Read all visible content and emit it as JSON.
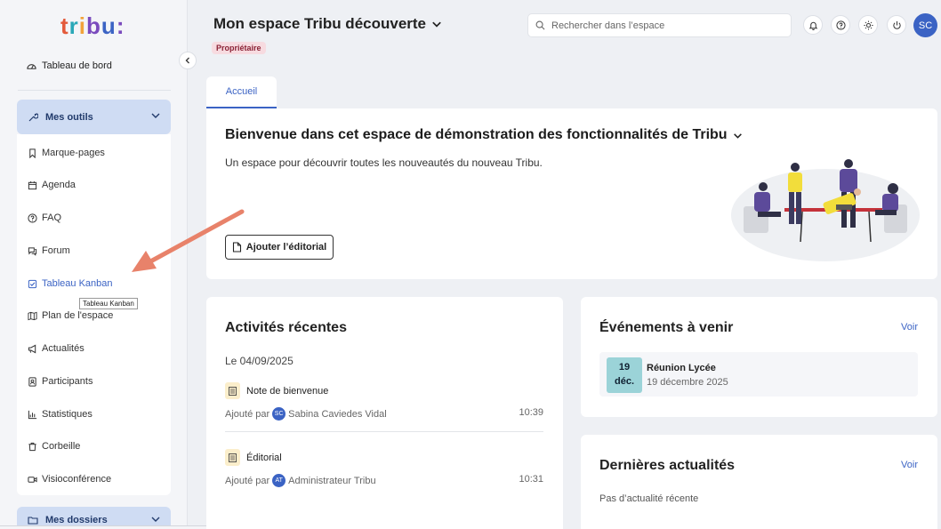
{
  "sidebar": {
    "logo": {
      "parts": [
        "t",
        "r",
        "i",
        "b",
        "u",
        ":"
      ]
    },
    "dashboard_label": "Tableau de bord",
    "tools_label": "Mes outils",
    "tools": [
      {
        "label": "Marque-pages",
        "icon": "bookmark-icon"
      },
      {
        "label": "Agenda",
        "icon": "calendar-icon"
      },
      {
        "label": "FAQ",
        "icon": "help-circle-icon"
      },
      {
        "label": "Forum",
        "icon": "forum-icon"
      },
      {
        "label": "Tableau Kanban",
        "icon": "kanban-check-icon"
      },
      {
        "label": "Plan de l'espace",
        "icon": "map-icon"
      },
      {
        "label": "Actualités",
        "icon": "megaphone-icon"
      },
      {
        "label": "Participants",
        "icon": "contacts-icon"
      },
      {
        "label": "Statistiques",
        "icon": "bar-chart-icon"
      },
      {
        "label": "Corbeille",
        "icon": "trash-icon"
      },
      {
        "label": "Visioconférence",
        "icon": "video-icon"
      }
    ],
    "tooltip": "Tableau Kanban",
    "folders_label": "Mes dossiers"
  },
  "header": {
    "space_title": "Mon espace Tribu découverte",
    "role_badge": "Propriétaire",
    "search_placeholder": "Rechercher dans l’espace",
    "avatar_initials": "SC"
  },
  "tabs": [
    {
      "label": "Accueil"
    }
  ],
  "welcome": {
    "title": "Bienvenue dans cet espace de démonstration des fonctionnalités de Tribu",
    "description": "Un espace pour découvrir toutes les nouveautés du nouveau Tribu.",
    "edit_button": "Ajouter l’éditorial"
  },
  "activities": {
    "title": "Activités récentes",
    "date": "Le 04/09/2025",
    "items": [
      {
        "title": "Note de bienvenue",
        "added_by": "Ajouté par",
        "initials": "SC",
        "author": "Sabina Caviedes Vidal",
        "time": "10:39"
      },
      {
        "title": "Éditorial",
        "added_by": "Ajouté par",
        "initials": "AT",
        "author": "Administrateur Tribu",
        "time": "10:31"
      }
    ]
  },
  "events": {
    "title": "Événements à venir",
    "link": "Voir",
    "items": [
      {
        "day": "19",
        "month": "déc.",
        "name": "Réunion Lycée",
        "when": "19 décembre 2025"
      }
    ]
  },
  "news": {
    "title": "Dernières actualités",
    "link": "Voir",
    "empty": "Pas d’actualité récente"
  },
  "colors": {
    "accent": "#3b63c4",
    "tools_bg": "#cfdcf3",
    "arrow": "#e8826a"
  }
}
